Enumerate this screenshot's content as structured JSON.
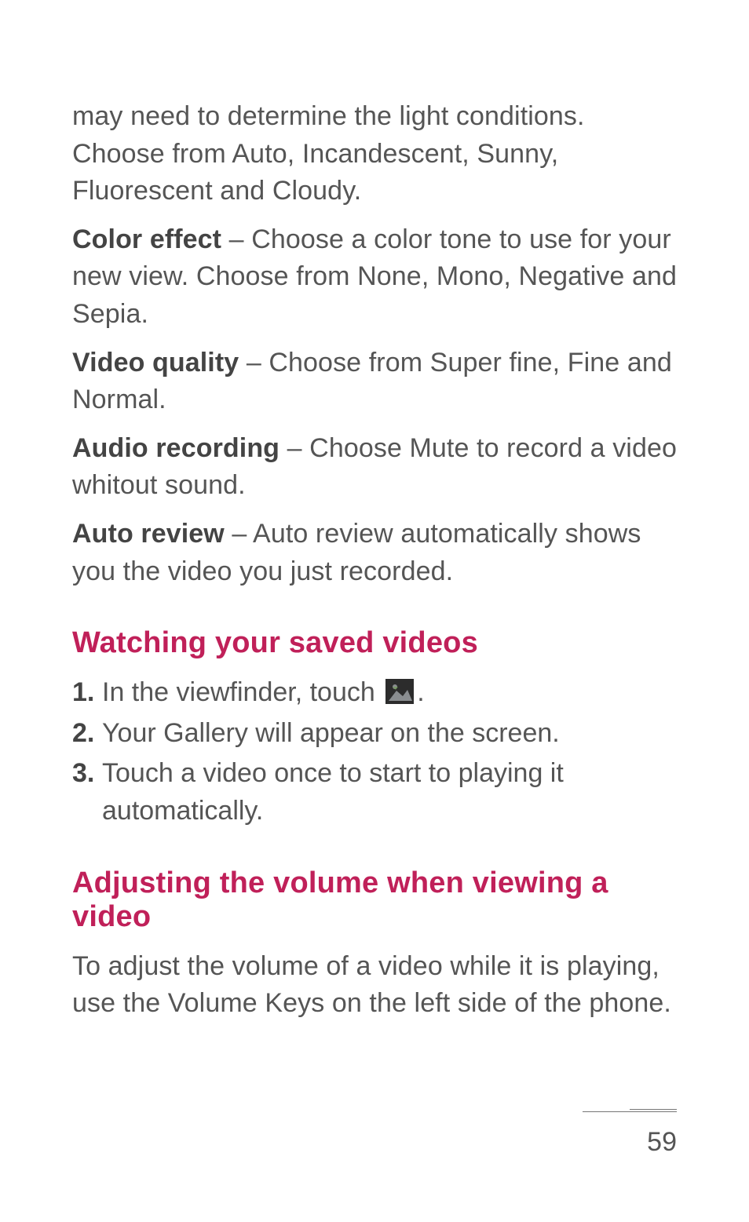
{
  "intro_para": "may need to determine the light conditions. Choose from Auto, Incandescent, Sunny, Fluorescent and Cloudy.",
  "settings": [
    {
      "label": "Color effect",
      "text": " – Choose a color tone to use for your new view. Choose from None,  Mono, Negative and Sepia."
    },
    {
      "label": "Video quality",
      "text": " – Choose from Super fine, Fine and Normal."
    },
    {
      "label": "Audio recording",
      "text": " – Choose Mute to record a video whitout sound."
    },
    {
      "label": "Auto review",
      "text": " – Auto review automatically shows you the video you just recorded."
    }
  ],
  "heading1": "Watching your saved videos",
  "steps": [
    {
      "num": "1.",
      "before": " In the viewfinder, touch ",
      "after": "."
    },
    {
      "num": "2.",
      "text": " Your Gallery will appear on the screen."
    },
    {
      "num": "3.",
      "text": " Touch a video once to start to playing it automatically."
    }
  ],
  "heading2": "Adjusting the volume when viewing a video",
  "volume_para": "To adjust the volume of a video while it is playing, use the Volume Keys on the left side of the phone.",
  "page_number": "59"
}
